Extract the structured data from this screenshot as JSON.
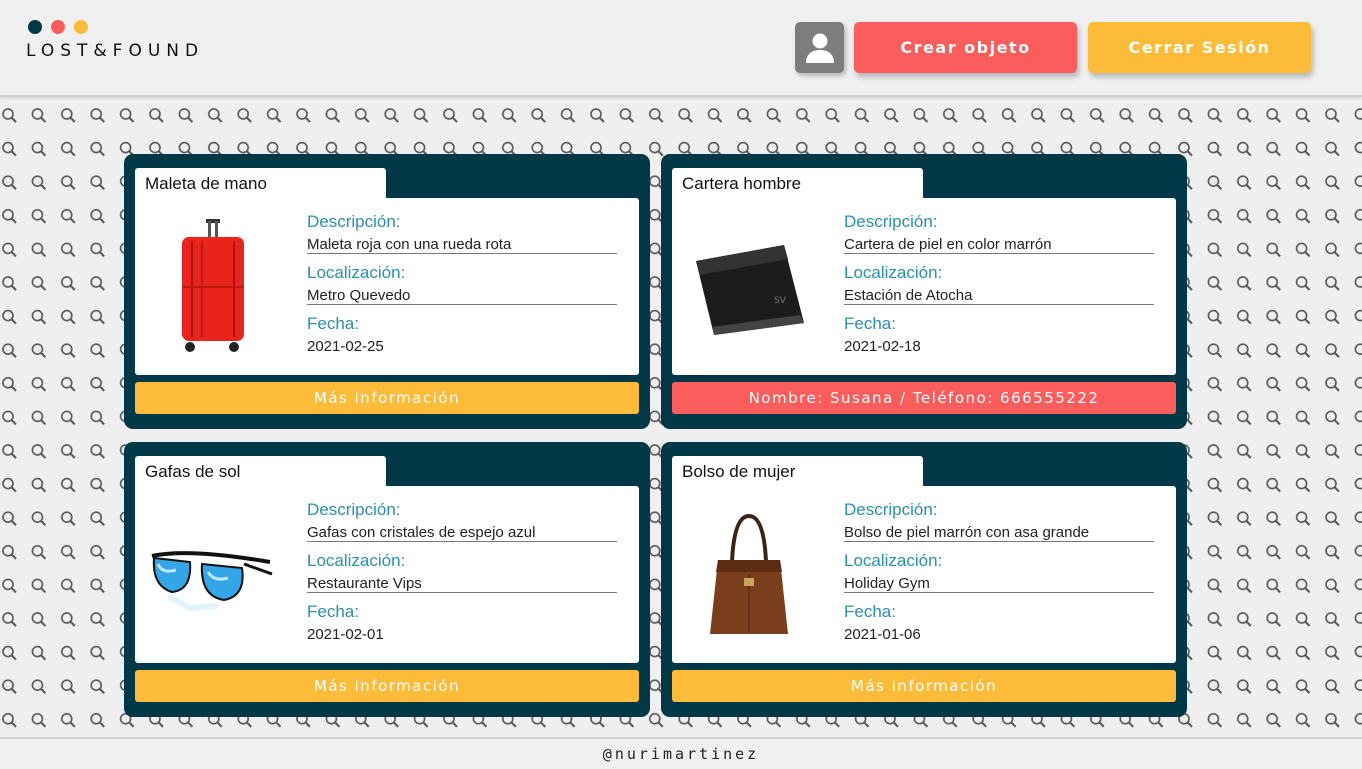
{
  "header": {
    "logo_text": "LOST&FOUND",
    "logo_dot_colors": [
      "#003847",
      "#fb5c5c",
      "#fcbc3a"
    ],
    "user_icon": "user-icon",
    "create_label": "Crear objeto",
    "logout_label": "Cerrar Sesión"
  },
  "background_icon": "search-icon",
  "labels": {
    "description": "Descripción:",
    "location": "Localización:",
    "date": "Fecha:"
  },
  "cards": [
    {
      "title": "Maleta de mano",
      "image_icon": "suitcase-icon",
      "description": "Maleta roja con una rueda rota",
      "location": "Metro Quevedo",
      "date": "2021-02-25",
      "footer": "Más información"
    },
    {
      "title": "Cartera hombre",
      "image_icon": "wallet-icon",
      "description": "Cartera de piel en color marrón",
      "location": "Estación de Atocha",
      "date": "2021-02-18",
      "footer": "Nombre: Susana / Teléfono: 666555222"
    },
    {
      "title": "Gafas de sol",
      "image_icon": "sunglasses-icon",
      "description": "Gafas con cristales de espejo azul",
      "location": "Restaurante Vips",
      "date": "2021-02-01",
      "footer": "Más información"
    },
    {
      "title": "Bolso de mujer",
      "image_icon": "handbag-icon",
      "description": "Bolso de piel marrón con asa grande",
      "location": "Holiday Gym",
      "date": "2021-01-06",
      "footer": "Más información"
    }
  ],
  "footer": {
    "text": "@nurimartinez"
  },
  "colors": {
    "dark": "#003847",
    "red": "#fb5c5c",
    "yellow": "#fcbc3a",
    "label_blue": "#2a8fb0"
  }
}
